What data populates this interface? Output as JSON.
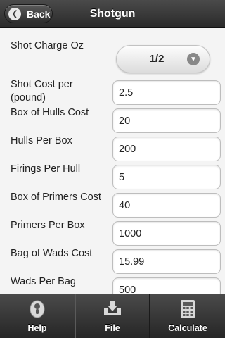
{
  "header": {
    "title": "Shotgun",
    "back_label": "Back"
  },
  "form": {
    "shot_charge": {
      "label": "Shot Charge Oz",
      "value": "1/2"
    },
    "fields": [
      {
        "label": "Shot Cost per (pound)",
        "value": "2.5"
      },
      {
        "label": "Box of Hulls Cost",
        "value": "20"
      },
      {
        "label": "Hulls Per Box",
        "value": "200"
      },
      {
        "label": "Firings Per Hull",
        "value": "5"
      },
      {
        "label": "Box of Primers Cost",
        "value": "40"
      },
      {
        "label": "Primers Per Box",
        "value": "1000"
      },
      {
        "label": "Bag of Wads Cost",
        "value": "15.99"
      },
      {
        "label": "Wads Per Bag",
        "value": "500"
      }
    ]
  },
  "toolbar": {
    "buttons": [
      {
        "label": "Help",
        "icon": "info-icon"
      },
      {
        "label": "File",
        "icon": "download-tray-icon"
      },
      {
        "label": "Calculate",
        "icon": "calculator-icon"
      }
    ]
  }
}
